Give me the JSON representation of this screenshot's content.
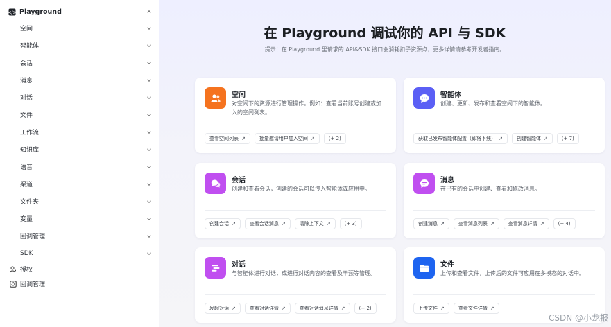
{
  "sidebar": {
    "header": "Playground",
    "items": [
      {
        "label": "空间"
      },
      {
        "label": "智能体"
      },
      {
        "label": "会话"
      },
      {
        "label": "消息"
      },
      {
        "label": "对话"
      },
      {
        "label": "文件"
      },
      {
        "label": "工作流"
      },
      {
        "label": "知识库"
      },
      {
        "label": "语音"
      },
      {
        "label": "渠道"
      },
      {
        "label": "文件夹"
      },
      {
        "label": "变量"
      },
      {
        "label": "回调管理"
      },
      {
        "label": "SDK"
      }
    ],
    "roots": [
      {
        "label": "授权",
        "icon": "user-key-icon"
      },
      {
        "label": "回调管理",
        "icon": "callback-icon"
      }
    ]
  },
  "main": {
    "title": "在 Playground 调试你的 API 与 SDK",
    "subtitle": "提示：在 Playground 里请求的 API&SDK 接口会消耗扣子资源点，更多详情请参考开发者指南。",
    "cards": [
      {
        "title": "空间",
        "desc": "对空间下的资源进行管理操作。例如：查看当前账号创建或加入的空间列表。",
        "icon": "space-users-icon",
        "color": "#f5731f",
        "links": [
          "查看空间列表",
          "批量邀请用户加入空间"
        ],
        "more": "(+ 2)"
      },
      {
        "title": "智能体",
        "desc": "创建、更新、发布和查看空间下的智能体。",
        "icon": "bot-chat-icon",
        "color": "#5b5ff5",
        "links": [
          "获取已发布智能体配置（即将下线）",
          "创建智能体"
        ],
        "more": "(+ 7)"
      },
      {
        "title": "会话",
        "desc": "创建和查看会话，创建的会话可以传入智能体或应用中。",
        "icon": "conversation-icon",
        "color": "#c04ff0",
        "links": [
          "创建会话",
          "查看会话消息",
          "清除上下文"
        ],
        "more": "(+ 3)"
      },
      {
        "title": "消息",
        "desc": "在已有的会话中创建、查看和修改消息。",
        "icon": "message-icon",
        "color": "#c04ff0",
        "links": [
          "创建消息",
          "查看消息列表",
          "查看消息详情"
        ],
        "more": "(+ 4)"
      },
      {
        "title": "对话",
        "desc": "与智能体进行对话，或进行对话内容的查看及干预等管理。",
        "icon": "dialog-lines-icon",
        "color": "#c04ff0",
        "links": [
          "发起对话",
          "查看对话详情",
          "查看对话消息详情"
        ],
        "more": "(+ 2)"
      },
      {
        "title": "文件",
        "desc": "上传和查看文件，上传后的文件可应用在多模态的对话中。",
        "icon": "folder-icon",
        "color": "#1e64f0",
        "links": [
          "上传文件",
          "查看文件详情"
        ],
        "more": ""
      }
    ]
  },
  "watermark": "CSDN @小龙报"
}
